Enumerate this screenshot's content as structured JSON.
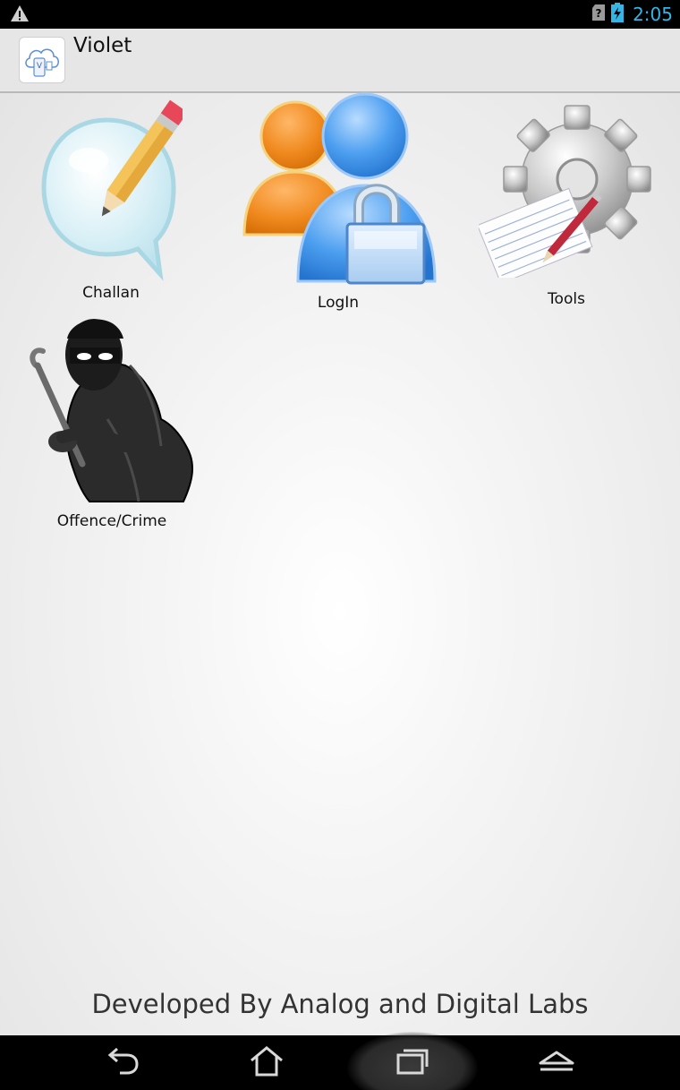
{
  "status_bar": {
    "time": "2:05",
    "icons": [
      "warning-icon",
      "sim-unknown-icon",
      "battery-charging-icon"
    ],
    "time_color": "#33b5e5"
  },
  "action_bar": {
    "title": "Violet",
    "app_icon": "violet-app-icon"
  },
  "tiles": [
    {
      "id": "challan",
      "label": "Challan",
      "icon": "speech-bubble-pencil-icon"
    },
    {
      "id": "login",
      "label": "LogIn",
      "icon": "users-lock-icon"
    },
    {
      "id": "tools",
      "label": "Tools",
      "icon": "gear-notepad-icon"
    },
    {
      "id": "offence",
      "label": "Offence/Crime",
      "icon": "thief-crowbar-icon"
    }
  ],
  "footer": {
    "text": "Developed By Analog and Digital Labs"
  },
  "nav_bar": {
    "buttons": [
      "back-icon",
      "home-icon",
      "recent-apps-icon",
      "menu-up-icon"
    ]
  }
}
